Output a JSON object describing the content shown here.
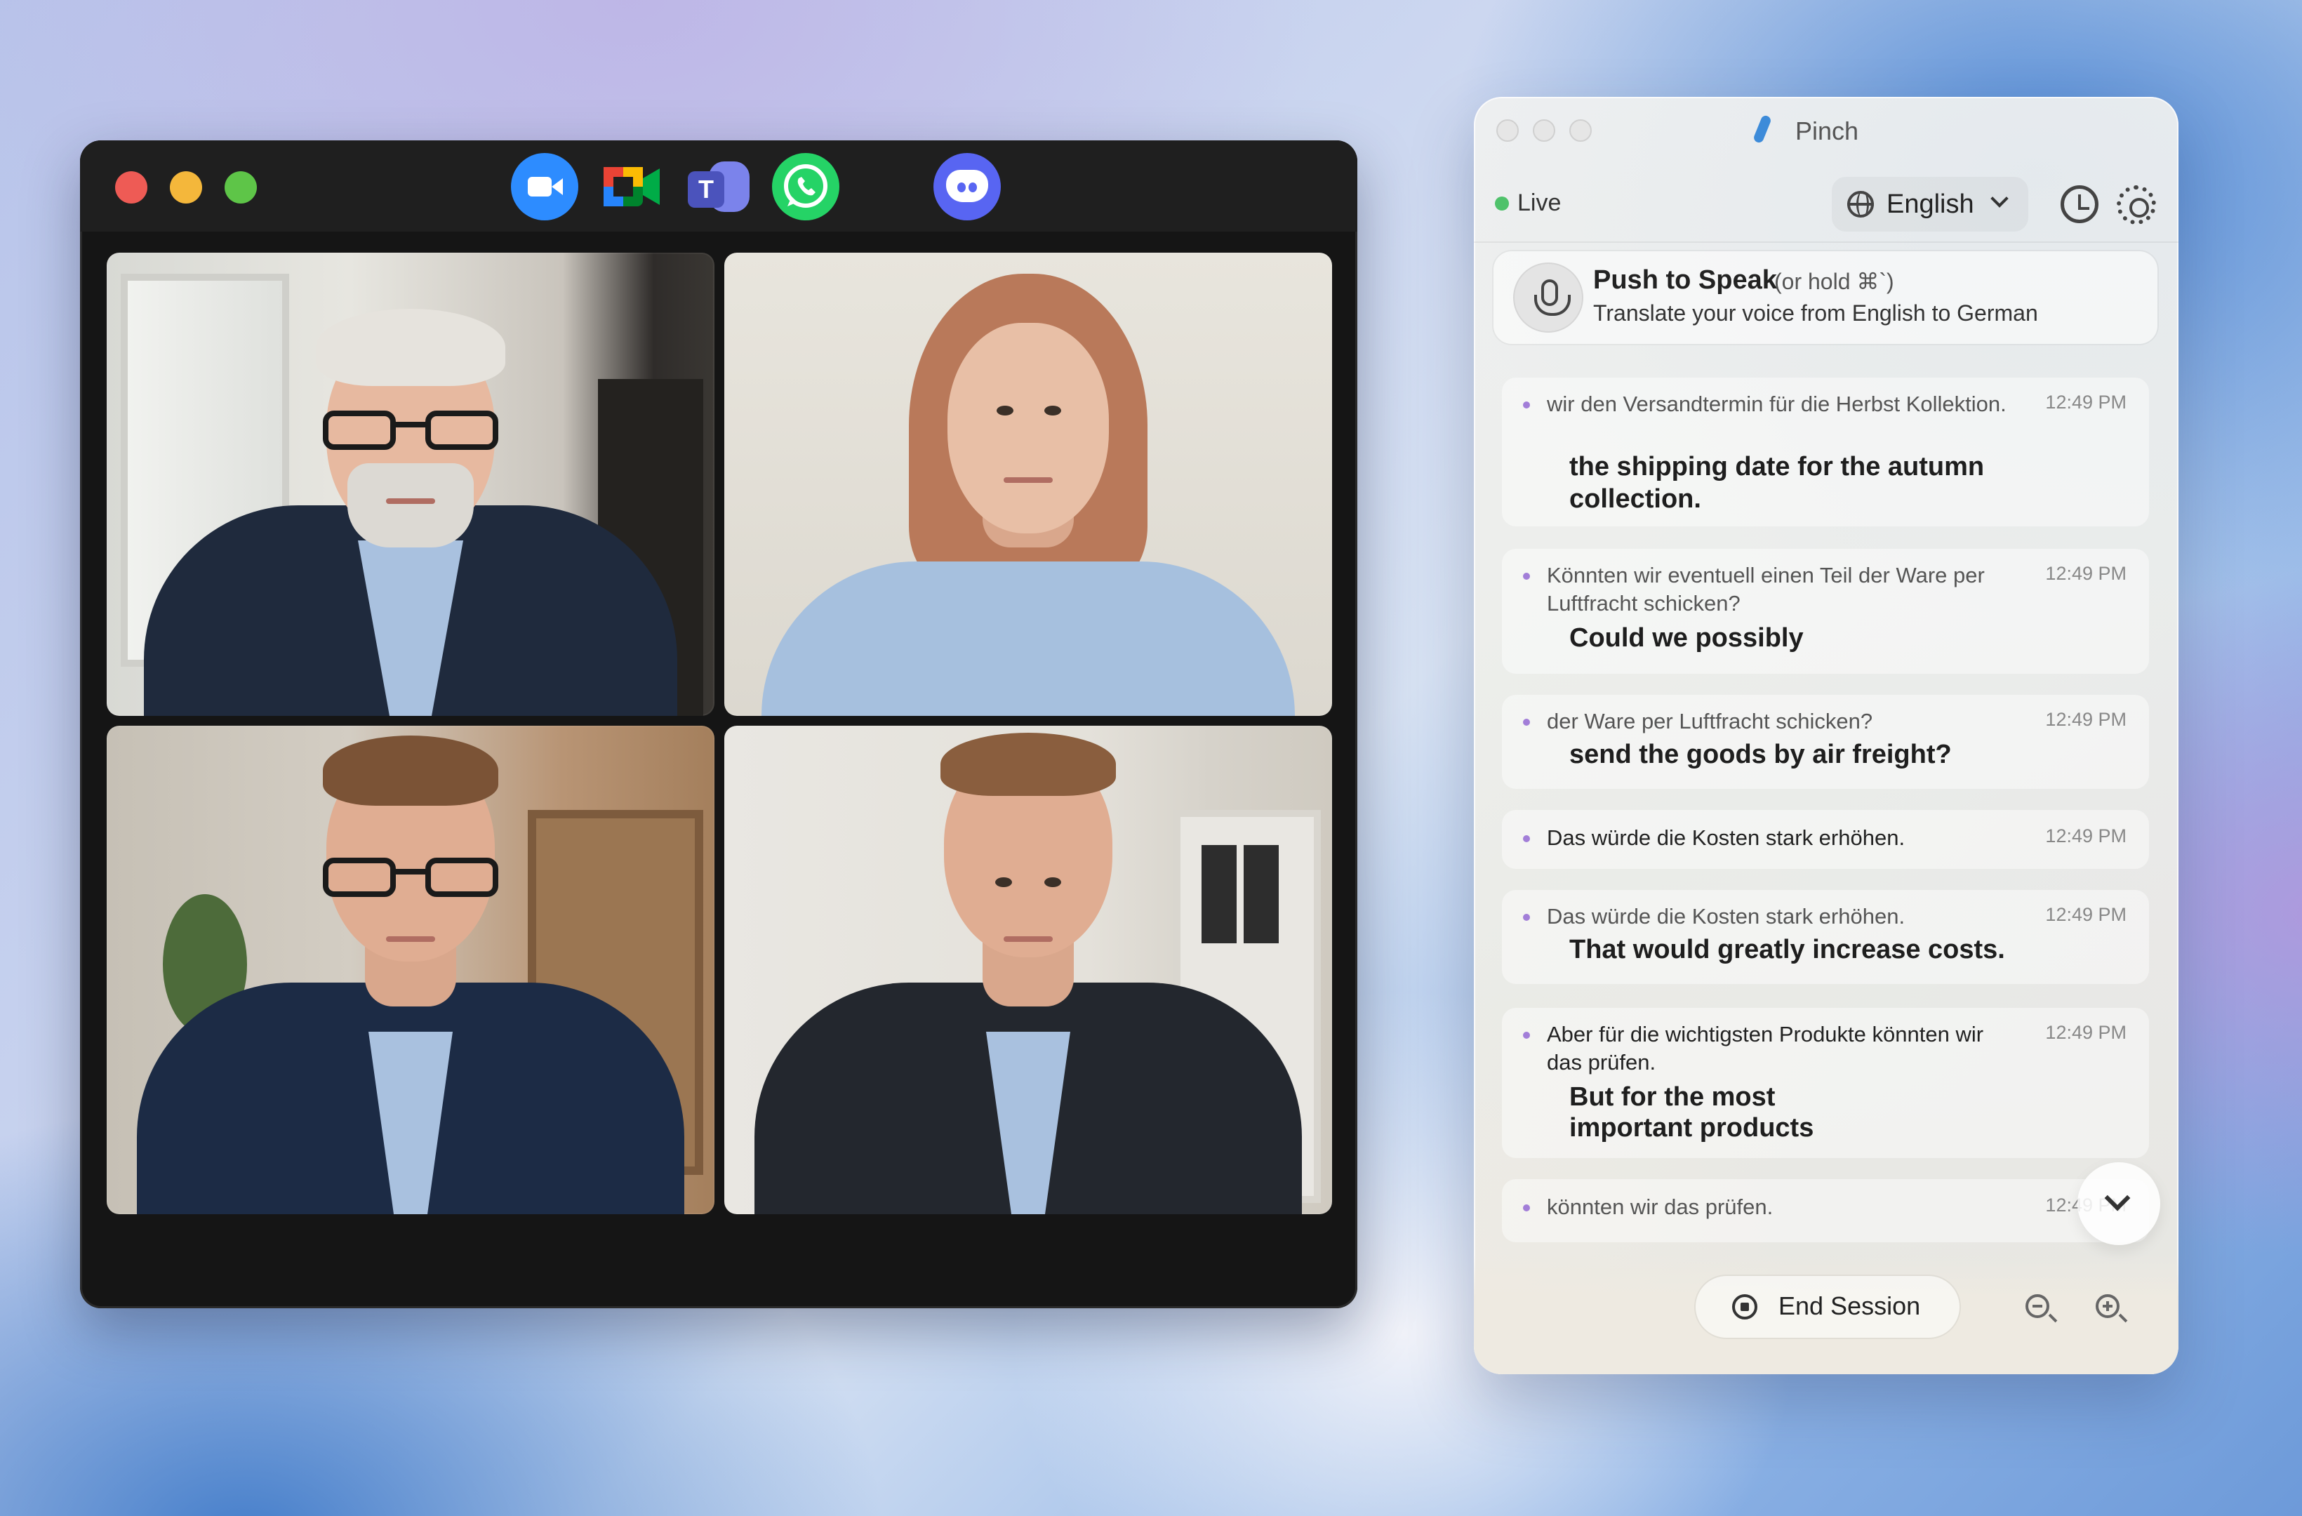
{
  "meeting_window": {
    "apps": [
      "zoom-icon",
      "google-meet-icon",
      "teams-icon",
      "whatsapp-icon",
      "discord-icon"
    ],
    "teams_letter": "T",
    "participants": [
      {
        "name": "participant-1"
      },
      {
        "name": "participant-2"
      },
      {
        "name": "participant-3"
      },
      {
        "name": "participant-4"
      }
    ]
  },
  "pinch": {
    "title": "Pinch",
    "status": "Live",
    "language": "English",
    "push_to_speak": {
      "title": "Push to Speak",
      "hint": "(or hold ⌘`)",
      "subtitle": "Translate your voice from English to German"
    },
    "messages": [
      {
        "source": "wir den Versandtermin für die Herbst Kollektion.",
        "translation_line1": "the shipping date for the autumn",
        "translation_line2": "collection.",
        "time": "12:49 PM"
      },
      {
        "source": "Könnten wir eventuell einen Teil der Ware per Luftfracht schicken?",
        "translation_line1": "Could we possibly",
        "translation_line2": "",
        "time": "12:49 PM"
      },
      {
        "source": "der Ware per Luftfracht schicken?",
        "translation_line1": "send the goods by air freight?",
        "translation_line2": "",
        "time": "12:49 PM"
      },
      {
        "source": "Das würde die Kosten stark erhöhen.",
        "translation_line1": "",
        "translation_line2": "",
        "time": "12:49 PM"
      },
      {
        "source": "Das würde die Kosten stark erhöhen.",
        "translation_line1": "That would greatly increase costs.",
        "translation_line2": "",
        "time": "12:49 PM"
      },
      {
        "source": "Aber für die wichtigsten Produkte könnten wir das prüfen.",
        "translation_line1": "But for the most",
        "translation_line2": "important products",
        "time": "12:49 PM"
      },
      {
        "source": "könnten wir das prüfen.",
        "translation_line1": "",
        "translation_line2": "",
        "time": "12:49 PM"
      }
    ],
    "end_session": "End Session"
  },
  "colors": {
    "live": "#4fc26b",
    "bullet": "#a27ed8",
    "zoom": "#2d8cff",
    "discord": "#5865f2",
    "whatsapp": "#25d366"
  }
}
